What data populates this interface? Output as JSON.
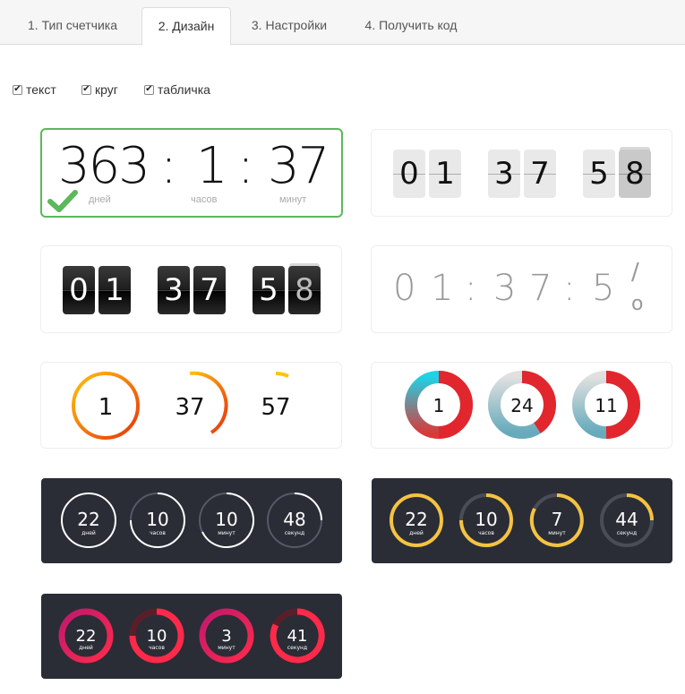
{
  "tabs": [
    {
      "label": "1. Тип счетчика"
    },
    {
      "label": "2. Дизайн"
    },
    {
      "label": "3. Настройки"
    },
    {
      "label": "4. Получить код"
    }
  ],
  "options": [
    {
      "label": "текст",
      "checked": true
    },
    {
      "label": "круг",
      "checked": true
    },
    {
      "label": "табличка",
      "checked": true
    }
  ],
  "design1": {
    "days": "363",
    "hours": "1",
    "minutes": "37",
    "sep": ":",
    "days_unit": "дней",
    "hours_unit": "часов",
    "minutes_unit": "минут"
  },
  "design2": {
    "digits": [
      "0",
      "1",
      "3",
      "7",
      "5",
      "8"
    ]
  },
  "design3": {
    "digits": [
      "0",
      "1",
      "3",
      "7",
      "5",
      "8"
    ]
  },
  "design4": {
    "text": [
      "0",
      "1",
      ":",
      "3",
      "7",
      ":",
      "5"
    ],
    "flip_top": "/",
    "flip_bottom": "o"
  },
  "design5": {
    "values": [
      "1",
      "37",
      "57"
    ]
  },
  "design6": {
    "values": [
      "1",
      "24",
      "11"
    ]
  },
  "design7": {
    "items": [
      {
        "value": "22",
        "unit": "дней"
      },
      {
        "value": "10",
        "unit": "часов"
      },
      {
        "value": "10",
        "unit": "минут"
      },
      {
        "value": "48",
        "unit": "секунд"
      }
    ]
  },
  "design8": {
    "items": [
      {
        "value": "22",
        "unit": "дней"
      },
      {
        "value": "10",
        "unit": "часов"
      },
      {
        "value": "7",
        "unit": "минут"
      },
      {
        "value": "44",
        "unit": "секунд"
      }
    ]
  },
  "design9": {
    "items": [
      {
        "value": "22",
        "unit": "дней"
      },
      {
        "value": "10",
        "unit": "часов"
      },
      {
        "value": "3",
        "unit": "минут"
      },
      {
        "value": "41",
        "unit": "секунд"
      }
    ]
  },
  "colors": {
    "selected_border": "#5cb85c",
    "dark_bg": "#2a2d36",
    "gold": "#f5c342",
    "pink": "#e8245c",
    "red": "#e2262d",
    "cyan": "#1fd2e6",
    "orange": "#f59a0c"
  }
}
